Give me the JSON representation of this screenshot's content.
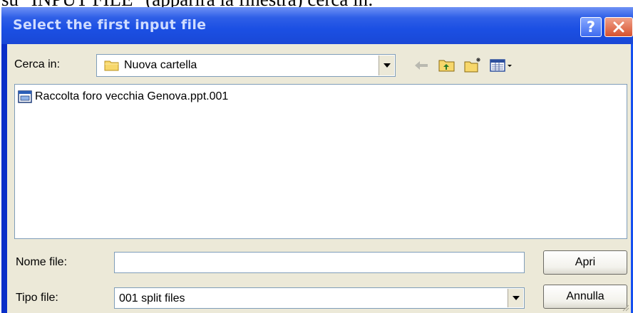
{
  "document": {
    "background_text": "su \"INPUT FILE\" (apparirà la finestra) cerca in:"
  },
  "dialog": {
    "title": "Select the first input file",
    "help_label": "?",
    "close_label": "✕"
  },
  "look_in": {
    "label": "Cerca in:",
    "value": "Nuova cartella",
    "icons": [
      "folder-icon",
      "back-arrow-icon",
      "up-folder-icon",
      "new-folder-icon",
      "view-menu-icon"
    ]
  },
  "files": [
    {
      "name": "Raccolta foro vecchia Genova.ppt.001",
      "icon": "file-icon"
    }
  ],
  "file_name": {
    "label": "Nome file:",
    "value": "",
    "placeholder": ""
  },
  "file_type": {
    "label": "Tipo file:",
    "value": "001 split files"
  },
  "buttons": {
    "open": "Apri",
    "cancel": "Annulla"
  },
  "colors": {
    "titlebar": "#1b4fe3",
    "dialog_face": "#ece9d8",
    "close_button": "#d8522e",
    "field_border": "#7f9db9"
  }
}
